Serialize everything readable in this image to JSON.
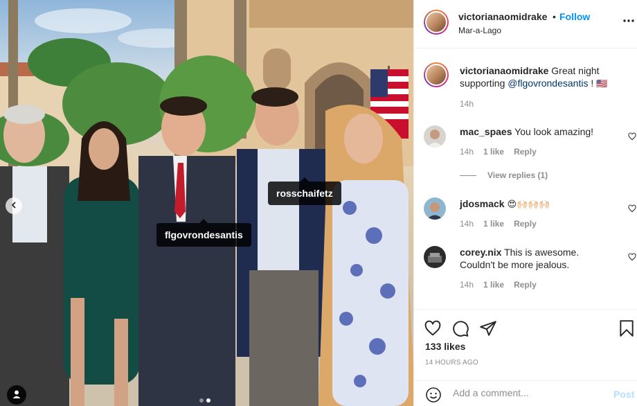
{
  "photo": {
    "tags": [
      "rosschaifetz",
      "flgovrondesantis"
    ],
    "carousel": {
      "count": 2,
      "active_index": 1
    }
  },
  "header": {
    "username": "victorianaomidrake",
    "separator": "•",
    "follow_label": "Follow",
    "location": "Mar-a-Lago"
  },
  "caption": {
    "username": "victorianaomidrake",
    "text": "Great night supporting",
    "mention": "@flgovrondesantis",
    "suffix": "!",
    "flag": "🇺🇸",
    "time": "14h"
  },
  "comments": [
    {
      "username": "mac_spaes",
      "text": "You look amazing!",
      "time": "14h",
      "likes": "1 like",
      "reply": "Reply",
      "view_replies": "View replies (1)"
    },
    {
      "username": "jdosmack",
      "text": "😍🙌🏻🙌🏻🙌🏻",
      "time": "14h",
      "likes": "1 like",
      "reply": "Reply"
    },
    {
      "username": "corey.nix",
      "text": "This is awesome. Couldn't be more jealous.",
      "time": "14h",
      "likes": "1 like",
      "reply": "Reply"
    }
  ],
  "post": {
    "likes": "133 likes",
    "time_ago": "14 HOURS AGO",
    "comment_placeholder": "Add a comment...",
    "post_label": "Post"
  },
  "colors": {
    "accent": "#0095f6",
    "muted": "#8e8e8e",
    "post_disabled": "#b2dffc"
  },
  "icons": [
    "chevron-left-icon",
    "user-tag-icon",
    "more-icon",
    "heart-icon",
    "comment-icon",
    "share-icon",
    "bookmark-icon",
    "emoji-icon"
  ]
}
